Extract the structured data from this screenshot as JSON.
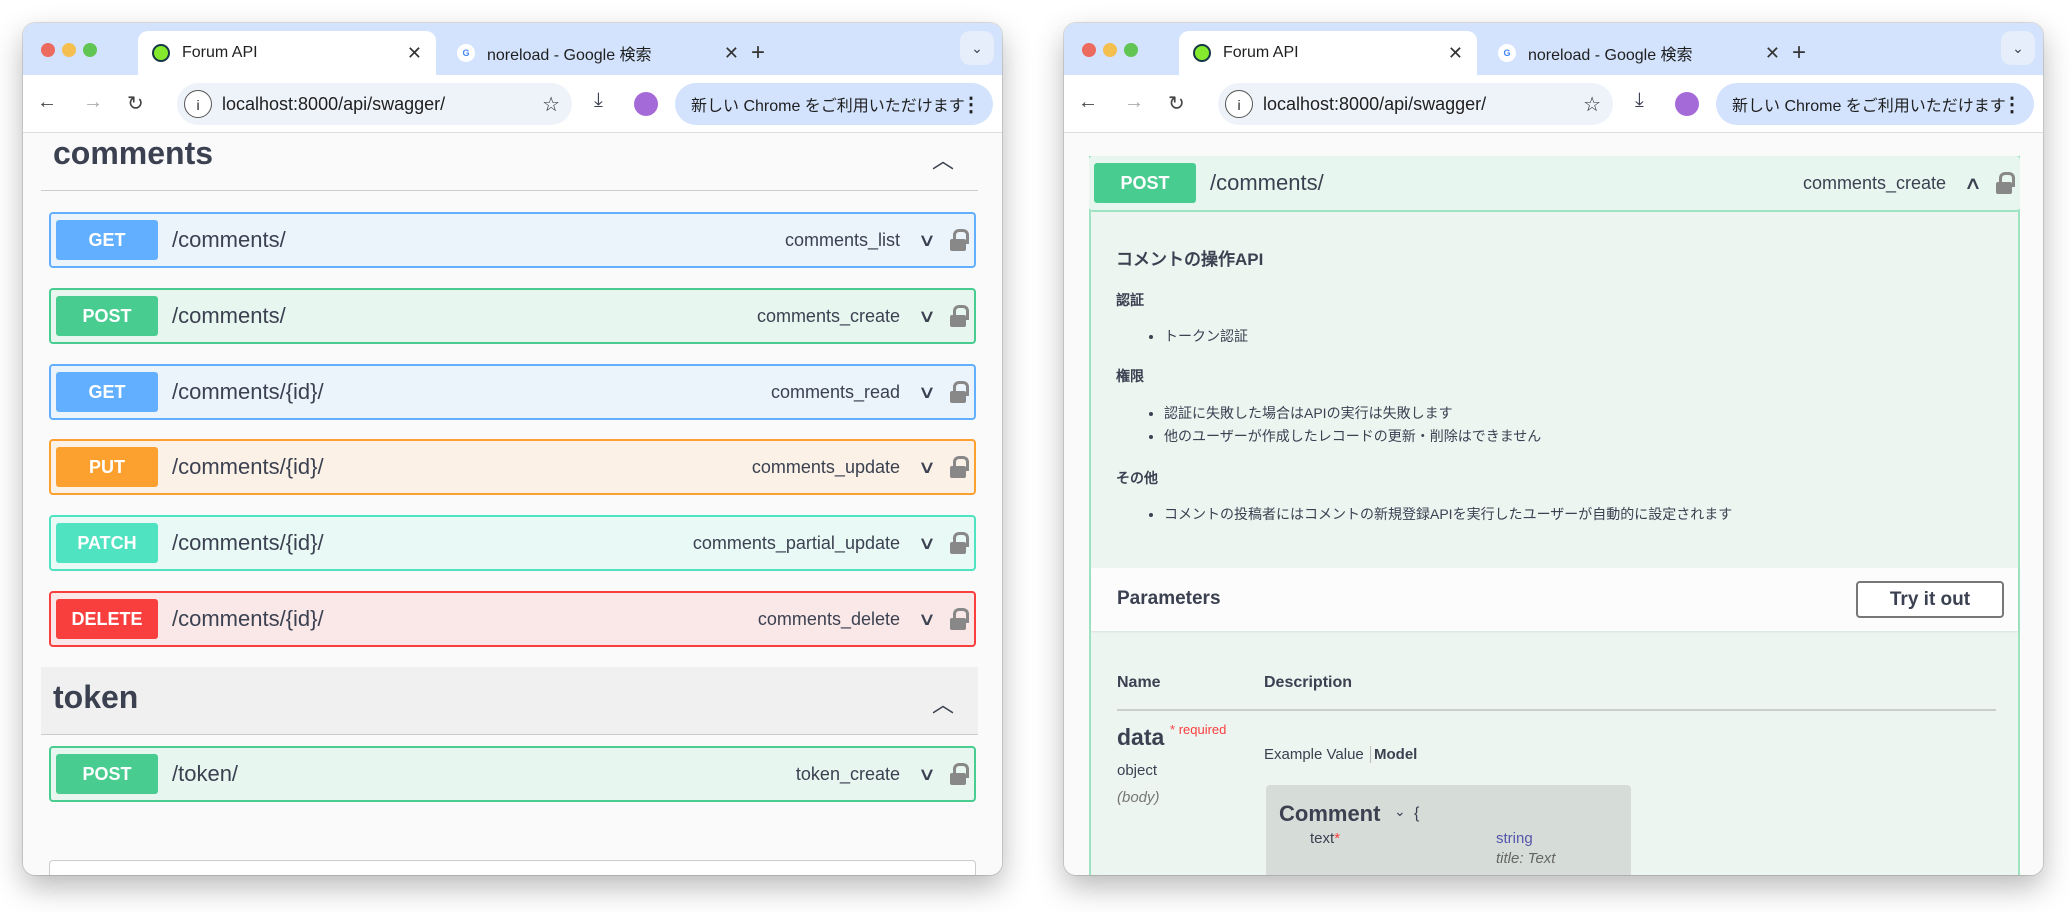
{
  "browser": {
    "tabs": [
      {
        "title": "Forum API",
        "favicon": "swagger-icon"
      },
      {
        "title": "noreload - Google 検索",
        "favicon": "google-icon"
      }
    ],
    "url": "localhost:8000/api/swagger/",
    "update_label": "新しい Chrome をご利用いただけます"
  },
  "left": {
    "sections": [
      {
        "title": "comments",
        "ops": [
          {
            "method": "GET",
            "path": "/comments/",
            "summary": "comments_list"
          },
          {
            "method": "POST",
            "path": "/comments/",
            "summary": "comments_create"
          },
          {
            "method": "GET",
            "path": "/comments/{id}/",
            "summary": "comments_read"
          },
          {
            "method": "PUT",
            "path": "/comments/{id}/",
            "summary": "comments_update"
          },
          {
            "method": "PATCH",
            "path": "/comments/{id}/",
            "summary": "comments_partial_update"
          },
          {
            "method": "DELETE",
            "path": "/comments/{id}/",
            "summary": "comments_delete"
          }
        ]
      },
      {
        "title": "token",
        "ops": [
          {
            "method": "POST",
            "path": "/token/",
            "summary": "token_create"
          }
        ]
      }
    ]
  },
  "right": {
    "op": {
      "method": "POST",
      "path": "/comments/",
      "summary": "comments_create"
    },
    "description": {
      "title": "コメントの操作API",
      "auth_heading": "認証",
      "auth_items": [
        "トークン認証"
      ],
      "perm_heading": "権限",
      "perm_items": [
        "認証に失敗した場合はAPIの実行は失敗します",
        "他のユーザーが作成したレコードの更新・削除はできません"
      ],
      "other_heading": "その他",
      "other_items": [
        "コメントの投稿者にはコメントの新規登録APIを実行したユーザーが自動的に設定されます"
      ]
    },
    "parameters": {
      "heading": "Parameters",
      "try_label": "Try it out",
      "col_name": "Name",
      "col_desc": "Description",
      "param": {
        "name": "data",
        "required_mark": "*",
        "required_label": "required",
        "type": "object",
        "in": "(body)"
      },
      "tab_example": "Example Value",
      "tab_model": "Model",
      "model": {
        "name": "Comment",
        "brace": "{",
        "field": "text",
        "field_req": "*",
        "field_type": "string",
        "field_title": "title: Text"
      }
    }
  },
  "colors": {
    "get": "#61affe",
    "post": "#49cc90",
    "put": "#fca130",
    "patch": "#50e3c2",
    "delete": "#f93e3e",
    "chrome_tabbar": "#d3e3fd"
  }
}
